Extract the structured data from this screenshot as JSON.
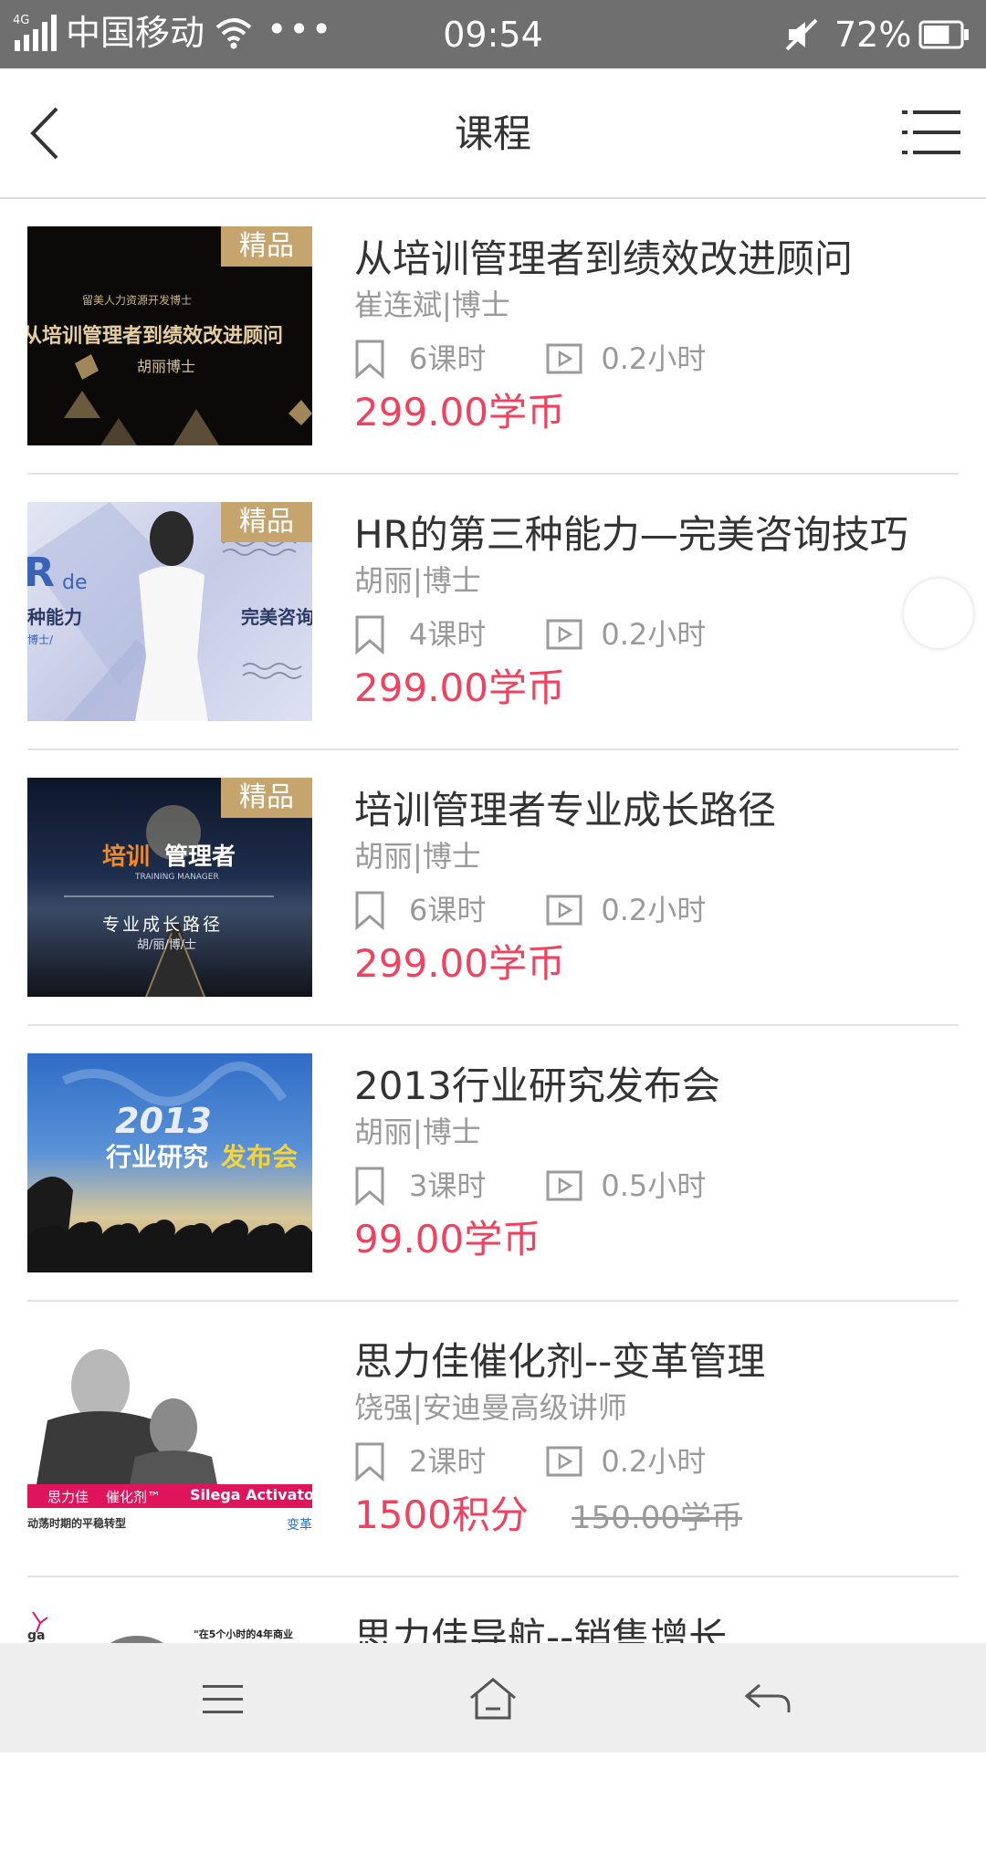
{
  "status_bar": {
    "network_type": "4G",
    "carrier": "中国移动",
    "more": "•••",
    "time": "09:54",
    "battery_percent": "72%",
    "battery_level": 0.72
  },
  "header": {
    "title": "课程",
    "back_icon": "chevron-left-icon",
    "menu_icon": "list-menu-icon"
  },
  "colors": {
    "price": "#f2415f",
    "badge": "#c6a46d",
    "muted": "#9a9a9a"
  },
  "courses": [
    {
      "badge": "精品",
      "title": "从培训管理者到绩效改进顾问",
      "author": "崔连斌|博士",
      "lessons": "6课时",
      "duration": "0.2小时",
      "price": "299.00学币",
      "thumb_lines": [
        "留美人力资源开发博士",
        "从培训管理者到绩效改进顾问",
        "胡丽博士"
      ]
    },
    {
      "badge": "精品",
      "title": "HR的第三种能力—完美咨询技巧",
      "author": "胡丽|博士",
      "lessons": "4课时",
      "duration": "0.2小时",
      "price": "299.00学币",
      "thumb_lines": [
        "R",
        "de",
        "种能力",
        "完美咨询",
        "博士/"
      ]
    },
    {
      "badge": "精品",
      "title": "培训管理者专业成长路径",
      "author": "胡丽|博士",
      "lessons": "6课时",
      "duration": "0.2小时",
      "price": "299.00学币",
      "thumb_lines": [
        "培训",
        "管理者",
        "TRAINING MANAGER",
        "专业成长路径",
        "胡/丽/博/士"
      ]
    },
    {
      "badge": "",
      "title": "2013行业研究发布会",
      "author": "胡丽|博士",
      "lessons": "3课时",
      "duration": "0.5小时",
      "price": "99.00学币",
      "thumb_lines": [
        "2013",
        "行业研究",
        "发布会"
      ]
    },
    {
      "badge": "",
      "title": "思力佳催化剂--变革管理",
      "author": "饶强|安迪曼高级讲师",
      "lessons": "2课时",
      "duration": "0.2小时",
      "price": "1500积分",
      "old_price": "150.00学币",
      "thumb_lines": [
        "思力佳",
        "催化剂™",
        "Silega Activator",
        "动荡时期的平稳转型",
        "变革"
      ]
    },
    {
      "badge": "",
      "title": "思力佳导航--销售增长",
      "thumb_lines": [
        "ga",
        "\"在5个小时的4年商业"
      ]
    }
  ],
  "system_nav": {
    "menu_icon": "menu-icon",
    "home_icon": "home-icon",
    "back_icon": "return-icon"
  }
}
